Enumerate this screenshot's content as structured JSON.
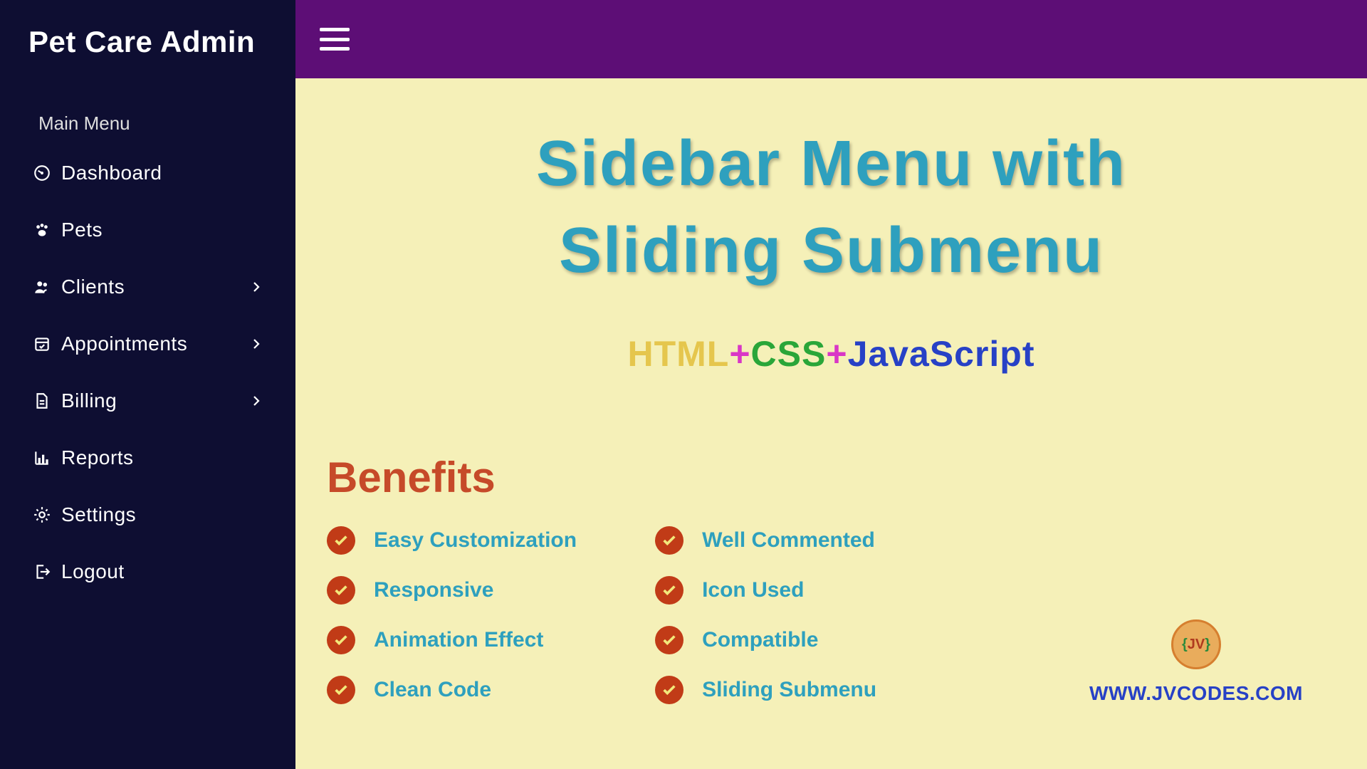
{
  "sidebar": {
    "brand": "Pet Care Admin",
    "section": "Main Menu",
    "items": [
      {
        "icon": "gauge",
        "label": "Dashboard",
        "expandable": false
      },
      {
        "icon": "paw",
        "label": "Pets",
        "expandable": false
      },
      {
        "icon": "users",
        "label": "Clients",
        "expandable": true
      },
      {
        "icon": "calendar",
        "label": "Appointments",
        "expandable": true
      },
      {
        "icon": "file",
        "label": "Billing",
        "expandable": true
      },
      {
        "icon": "chart",
        "label": "Reports",
        "expandable": false
      },
      {
        "icon": "gear",
        "label": "Settings",
        "expandable": false
      },
      {
        "icon": "logout",
        "label": "Logout",
        "expandable": false
      }
    ]
  },
  "hero": {
    "line1": "Sidebar Menu with",
    "line2": "Sliding Submenu",
    "sub_html": "HTML",
    "sub_plus": "+",
    "sub_css": "CSS",
    "sub_js": "JavaScript"
  },
  "benefits": {
    "heading": "Benefits",
    "col1": [
      "Easy Customization",
      "Responsive",
      "Animation Effect",
      "Clean Code"
    ],
    "col2": [
      "Well Commented",
      "Icon Used",
      "Compatible",
      "Sliding Submenu"
    ]
  },
  "footer": {
    "badge_text": "JV",
    "url": "WWW.JVCODES.COM"
  }
}
